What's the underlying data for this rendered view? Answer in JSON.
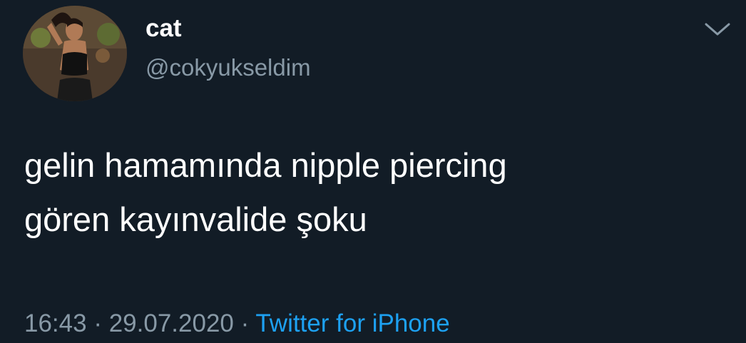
{
  "tweet": {
    "display_name": "cat",
    "handle": "@cokyukseldim",
    "text_line1": "gelin hamamında nipple piercing",
    "text_line2": "gören kayınvalide şoku",
    "time": "16:43",
    "separator1": " · ",
    "date": "29.07.2020",
    "separator2": " · ",
    "source": "Twitter for iPhone",
    "menu_icon": "chevron-down-icon",
    "avatar_icon": "profile-photo"
  },
  "colors": {
    "background": "#121c26",
    "primary_text": "#ffffff",
    "secondary_text": "#8899a6",
    "link": "#1da1f2"
  }
}
